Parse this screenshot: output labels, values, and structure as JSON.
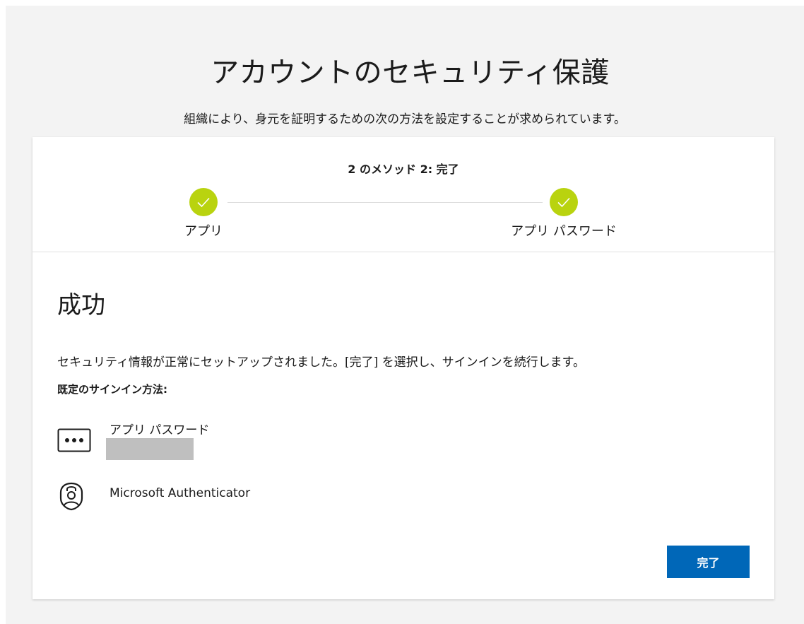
{
  "header": {
    "title": "アカウントのセキュリティ保護",
    "subtitle": "組織により、身元を証明するための次の方法を設定することが求められています。"
  },
  "progress": {
    "step_count_text": "2 のメソッド 2: 完了",
    "steps": [
      {
        "label": "アプリ",
        "status": "complete"
      },
      {
        "label": "アプリ パスワード",
        "status": "complete"
      }
    ]
  },
  "content": {
    "title": "成功",
    "message": "セキュリティ情報が正常にセットアップされました。[完了] を選択し、サインインを続行します。",
    "default_methods_label": "既定のサインイン方法:",
    "methods": [
      {
        "name": "アプリ パスワード",
        "icon": "password-dots-icon",
        "detail_redacted": true
      },
      {
        "name": "Microsoft Authenticator",
        "icon": "authenticator-lock-icon"
      }
    ]
  },
  "actions": {
    "done_label": "完了"
  },
  "colors": {
    "page_background": "#f3f3f3",
    "step_complete": "#b9d30f",
    "primary_button": "#0067b8",
    "redaction": "#bfbfbf"
  }
}
